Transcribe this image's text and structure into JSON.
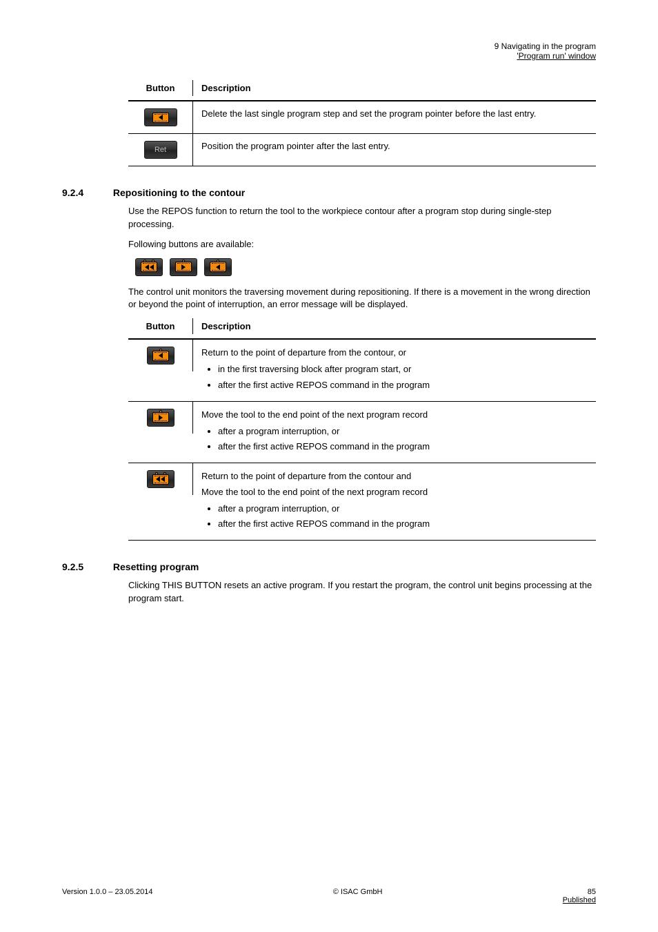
{
  "header": {
    "left": "",
    "right_line1": "9  Navigating in the program",
    "right_line2": "'Program run' window"
  },
  "table1": {
    "head_button": "Button",
    "head_desc": "Description",
    "rows": [
      {
        "icon": "back-arrow",
        "desc": "Delete the last single program step and set the program pointer before the last entry."
      },
      {
        "icon": "ret",
        "desc": "Position the program pointer after the last entry."
      }
    ]
  },
  "section1": {
    "number": "9.2.4",
    "title": "Repositioning to the contour",
    "para1": "Use the REPOS function to return the tool to the workpiece contour after a program stop during single-step processing.",
    "para2": "Following buttons are available:",
    "para3": "The control unit monitors the traversing movement during repositioning. If there is a movement in the wrong direction or beyond the point of interruption, an error message will be displayed."
  },
  "table2": {
    "head_button": "Button",
    "head_desc": "Description",
    "rows": [
      {
        "icon": "repos-last",
        "heading": "Return to the point of departure from the contour, or",
        "bullets": [
          "in the first traversing block after program start, or",
          "after the first active REPOS command in the program"
        ]
      },
      {
        "icon": "repos-next",
        "heading": "Move the tool to the end point of the next program record",
        "bullets": [
          "after a program interruption, or",
          "after the first active REPOS command in the program"
        ]
      },
      {
        "icon": "repos-both",
        "heading1": "Return to the point of departure from the contour and",
        "heading2": "Move the tool to the end point of the next program record",
        "bullets": [
          "after a program interruption, or",
          "after the first active REPOS command in the program"
        ]
      }
    ]
  },
  "section2": {
    "number": "9.2.5",
    "title": "Resetting program",
    "para": "Clicking THIS BUTTON resets an active program. If you restart the program, the control unit begins processing at the program start."
  },
  "footer": {
    "left": "Version 1.0.0 – 23.05.2014",
    "center": "© ISAC GmbH",
    "right_top": "85",
    "right_bottom": "Published"
  }
}
